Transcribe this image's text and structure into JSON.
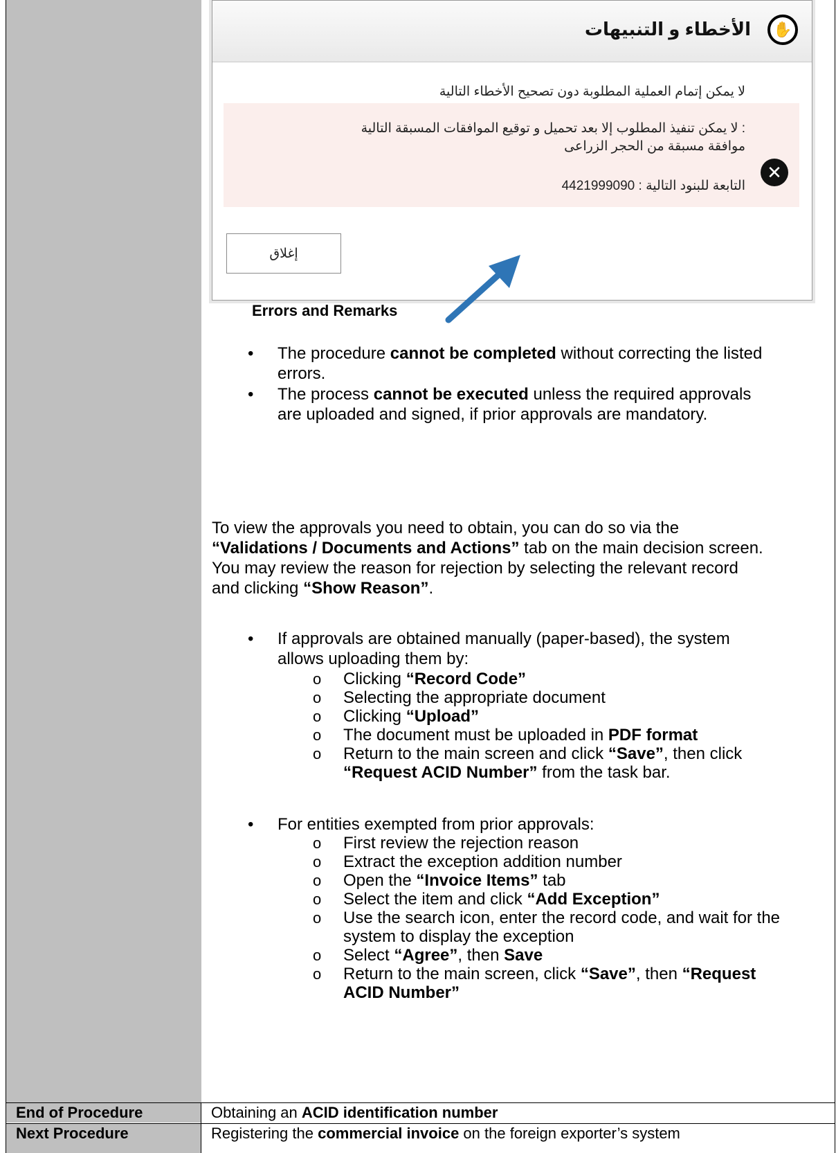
{
  "dialog": {
    "title": "الأخطاء و التنبيهات",
    "message": "لا يمكن إتمام العملية المطلوبة دون تصحيح الأخطاء التالية",
    "error_line1": ": لا يمكن تنفيذ المطلوب إلا بعد تحميل و توقيع الموافقات المسبقة التالية",
    "error_line2": "موافقة مسبقة من  الحجر الزراعى",
    "error_line3": "التابعة للبنود التالية : 4421999090",
    "close_label": "إغلاق",
    "icons": {
      "header": "hand-stop-icon",
      "error": "error-x-icon"
    }
  },
  "caption": "Errors and Remarks",
  "bullets": {
    "b1_pre": "The procedure ",
    "b1_bold": "cannot be completed",
    "b1_post": " without correcting the listed",
    "b1_line2": "errors.",
    "b2_pre": "The process ",
    "b2_bold": "cannot be executed",
    "b2_post": " unless the required approvals",
    "b2_line2": "are uploaded and signed, if prior approvals are mandatory."
  },
  "para": {
    "l1": "To view the approvals you need to obtain, you can do so via the",
    "l2_bold": "“Validations / Documents and Actions”",
    "l2_post": " tab on the main decision screen.",
    "l3": "You may review the reason for rejection by selecting the relevant record",
    "l4_pre": "and clicking ",
    "l4_bold": "“Show Reason”",
    "l4_post": "."
  },
  "manual": {
    "intro1": "If approvals are obtained manually (paper-based), the system",
    "intro2": "allows uploading them by:",
    "s1_pre": "Clicking ",
    "s1_bold": "“Record Code”",
    "s2": "Selecting the appropriate document",
    "s3_pre": "Clicking ",
    "s3_bold": "“Upload”",
    "s4_pre": "The document must be uploaded in ",
    "s4_bold": "PDF format",
    "s5_pre": "Return to the main screen and click ",
    "s5_bold": "“Save”",
    "s5_post": ", then click",
    "s5_l2_bold": "“Request ACID Number”",
    "s5_l2_post": " from the task bar."
  },
  "exempt": {
    "intro": "For entities exempted from prior approvals:",
    "s1": "First review the rejection reason",
    "s2": "Extract the exception addition number",
    "s3_pre": "Open the ",
    "s3_bold": "“Invoice Items”",
    "s3_post": " tab",
    "s4_pre": "Select the item and click ",
    "s4_bold": "“Add Exception”",
    "s5_l1": "Use the search icon, enter the record code, and wait for the",
    "s5_l2": "system to display the exception",
    "s6_pre": "Select ",
    "s6_bold": "“Agree”",
    "s6_mid": ", then ",
    "s6_bold2": "Save",
    "s7_pre": "Return to the main screen, click ",
    "s7_bold": "“Save”",
    "s7_mid": ", then ",
    "s7_bold2": "“Request",
    "s7_l2_bold": "ACID Number”"
  },
  "rows": {
    "end_label": "End of Procedure",
    "end_pre": "Obtaining an ",
    "end_bold": "ACID identification number",
    "next_label": "Next Procedure",
    "next_pre": "Registering the ",
    "next_bold": "commercial invoice",
    "next_post": " on the foreign exporter’s system"
  }
}
